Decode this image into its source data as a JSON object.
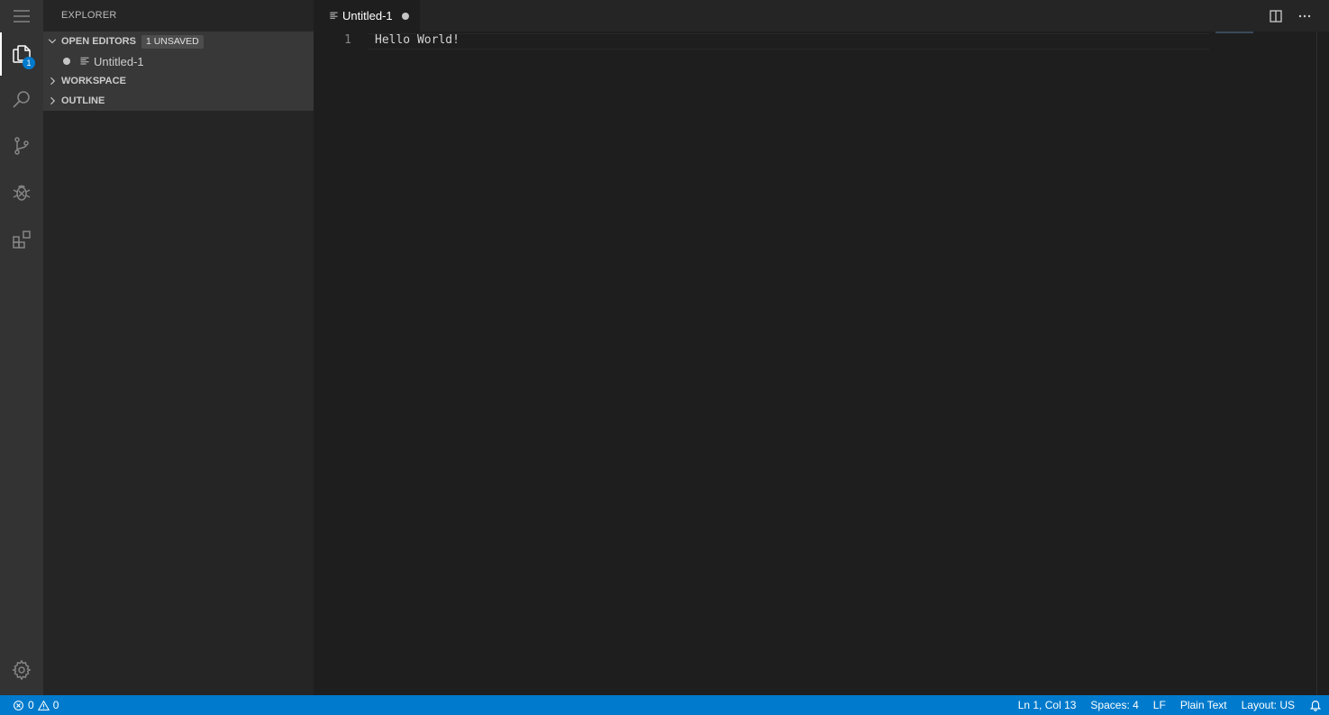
{
  "sidebar": {
    "title": "EXPLORER",
    "open_editors": {
      "label": "OPEN EDITORS",
      "badge": "1 UNSAVED",
      "items": [
        {
          "label": "Untitled-1"
        }
      ]
    },
    "workspace_label": "WORKSPACE",
    "outline_label": "OUTLINE"
  },
  "activity_bar": {
    "explorer_badge": "1",
    "icons": [
      "menu-icon",
      "files-icon",
      "search-icon",
      "source-control-icon",
      "debug-icon",
      "extensions-icon",
      "gear-icon"
    ]
  },
  "editor": {
    "tab_label": "Untitled-1",
    "lines": [
      {
        "number": "1",
        "text": "Hello World!"
      }
    ]
  },
  "status_bar": {
    "errors": "0",
    "warnings": "0",
    "position": "Ln 1, Col 13",
    "spaces": "Spaces: 4",
    "eol": "LF",
    "language": "Plain Text",
    "layout": "Layout: US"
  },
  "colors": {
    "status_bar_bg": "#007acc",
    "activity_bar_bg": "#333333",
    "sidebar_bg": "#252526",
    "editor_bg": "#1e1e1e"
  }
}
